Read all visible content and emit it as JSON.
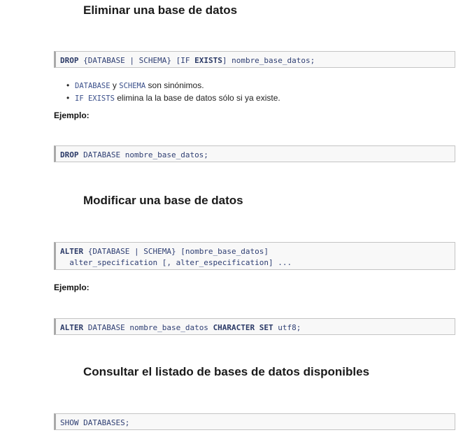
{
  "sections": [
    {
      "title": "Eliminar una base de datos",
      "syntax": {
        "kw1": "DROP",
        "t1": " {DATABASE | SCHEMA} [IF ",
        "kw2": "EXISTS",
        "t2": "] nombre_base_datos;"
      },
      "bullets": [
        {
          "code": "DATABASE",
          "mid": " y ",
          "code2": "SCHEMA",
          "text": " son sinónimos."
        },
        {
          "code": "IF EXISTS",
          "text": " elimina la la base de datos sólo si ya existe."
        }
      ],
      "example_label": "Ejemplo:",
      "example": {
        "kw1": "DROP",
        "t1": " DATABASE nombre_base_datos;"
      }
    },
    {
      "title": "Modificar una base de datos",
      "syntax": {
        "kw1": "ALTER",
        "t1": " {DATABASE | SCHEMA} [nombre_base_datos]",
        "line2": "  alter_specification [, alter_especification] ..."
      },
      "example_label": "Ejemplo:",
      "example": {
        "kw1": "ALTER",
        "t1": " DATABASE nombre_base_datos ",
        "kw2": "CHARACTER SET",
        "t2": " utf8;"
      }
    },
    {
      "title": "Consultar el listado de bases de datos disponibles",
      "syntax": {
        "t1": "SHOW DATABASES;"
      }
    }
  ]
}
